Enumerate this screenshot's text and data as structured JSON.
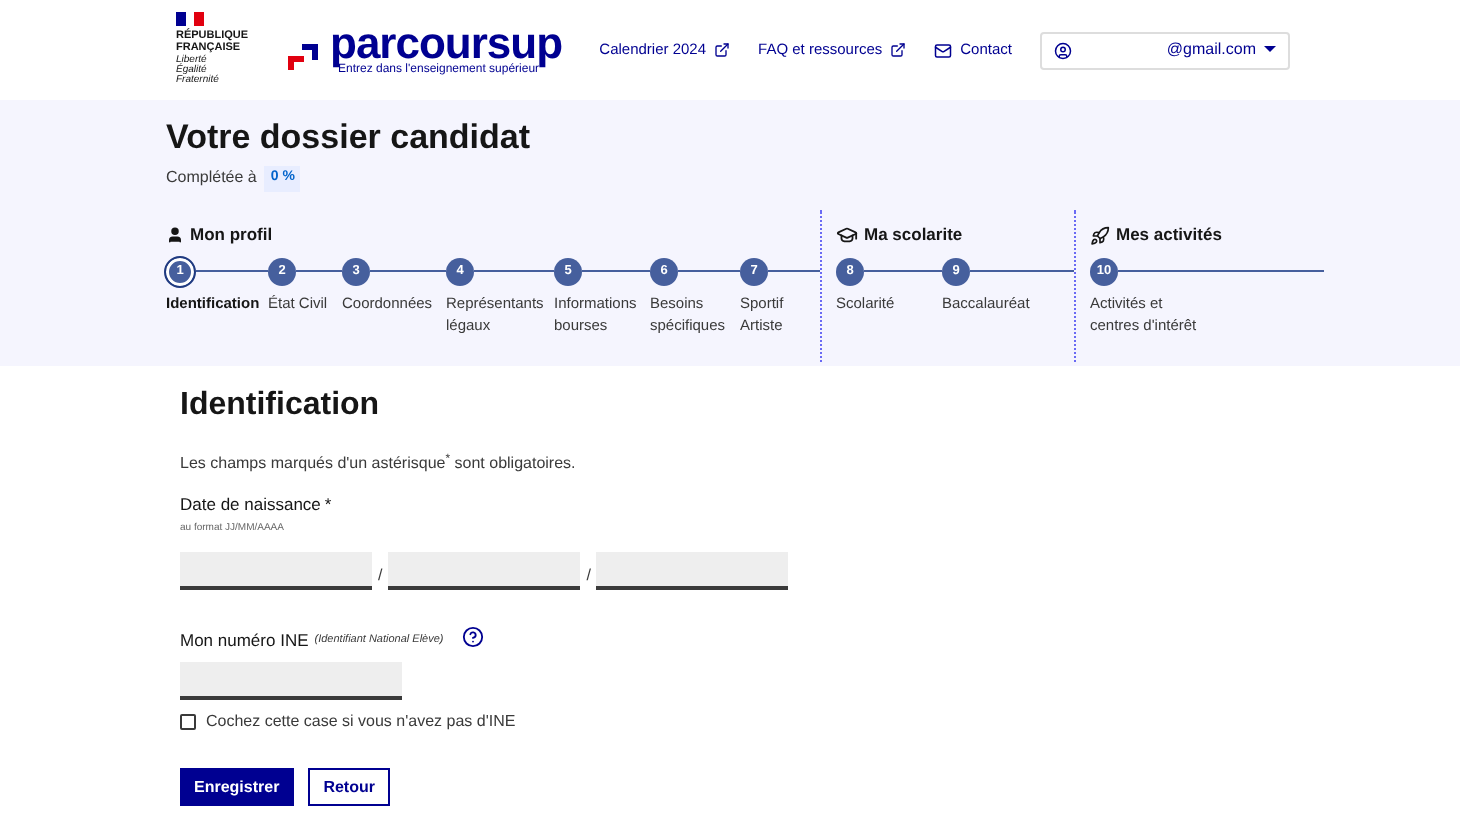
{
  "header": {
    "republic": [
      "RÉPUBLIQUE",
      "FRANÇAISE"
    ],
    "motto": [
      "Liberté",
      "Égalité",
      "Fraternité"
    ],
    "brand": "parcoursup",
    "tagline": "Entrez dans l'enseignement supérieur",
    "nav": [
      {
        "label": "Calendrier 2024",
        "kind": "external"
      },
      {
        "label": "FAQ et ressources",
        "kind": "external"
      },
      {
        "label": "Contact",
        "kind": "mail"
      }
    ],
    "account": "@gmail.com"
  },
  "dossier": {
    "title": "Votre dossier candidat",
    "completion_label": "Complétée à",
    "completion": "0 %"
  },
  "sections": [
    {
      "title": "Mon profil",
      "kind": "user",
      "steps": [
        {
          "number": "1",
          "label": "Identification",
          "selected": true
        },
        {
          "number": "2",
          "label": "État Civil",
          "selected": false
        },
        {
          "number": "3",
          "label": "Coordonnées",
          "selected": false
        },
        {
          "number": "4",
          "label": "Représentants légaux",
          "selected": false
        },
        {
          "number": "5",
          "label": "Informations bourses",
          "selected": false
        },
        {
          "number": "6",
          "label": "Besoins spécifiques",
          "selected": false
        },
        {
          "number": "7",
          "label": "Sportif Artiste",
          "selected": false
        }
      ]
    },
    {
      "title": "Ma scolarite",
      "kind": "graduation",
      "steps": [
        {
          "number": "8",
          "label": "Scolarité",
          "selected": false
        },
        {
          "number": "9",
          "label": "Baccalauréat",
          "selected": false
        }
      ]
    },
    {
      "title": "Mes activités",
      "kind": "rocket",
      "steps": [
        {
          "number": "10",
          "label": "Activités et centres d'intérêt",
          "selected": false
        }
      ]
    }
  ],
  "form": {
    "title": "Identification",
    "required_note": "Les champs marqués d'un astérisque$^{*}$ sont obligatoires.",
    "birth_label": "Date de naissance",
    "required_mark": "*",
    "birth_hint": "au format JJ/MM/AAAA",
    "date_parts": [
      {
        "kind": "field"
      },
      {
        "kind": "separator",
        "text": "/"
      },
      {
        "kind": "field"
      },
      {
        "kind": "separator",
        "text": "/"
      },
      {
        "kind": "field"
      }
    ],
    "ine_label": "Mon numéro INE",
    "ine_note": "(Identifiant National Elève)",
    "ine_checkbox": {
      "label": "Cochez cette case si vous n'avez pas d'INE",
      "checked": false
    },
    "buttons": [
      {
        "label": "Enregistrer",
        "kind": "primary"
      },
      {
        "label": "Retour",
        "kind": "secondary"
      }
    ]
  }
}
